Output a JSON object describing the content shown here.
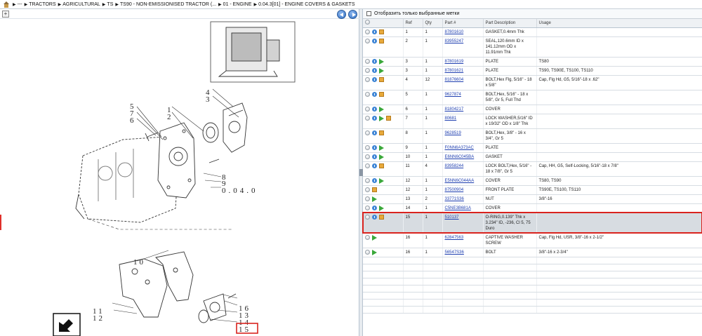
{
  "breadcrumb": [
    "---",
    "TRACTORS",
    "AGRICULTURAL",
    "TS",
    "TS90 - NON-EMISSIONISED TRACTOR (...",
    "01 - ENGINE",
    "0.04.3[01] - ENGINE COVERS & GASKETS"
  ],
  "toolbar": {
    "zoom_label": "+"
  },
  "drawing": {
    "callouts": [
      "1",
      "2",
      "3",
      "4",
      "5",
      "6",
      "7",
      "8",
      "9",
      "10",
      "11",
      "12",
      "13",
      "14",
      "15",
      "16"
    ],
    "group_label": "0.04.0"
  },
  "filter": {
    "label": "Отобразить только выбранные метки"
  },
  "table": {
    "columns": [
      "Ref",
      "Qty",
      "Part #",
      "Part Description",
      "Usage"
    ],
    "rows": [
      {
        "icons": [
          "circle",
          "info",
          "box"
        ],
        "ref": "1",
        "qty": "1",
        "part": "87801610",
        "desc": "GASKET,0.4mm Thk",
        "usage": ""
      },
      {
        "icons": [
          "circle",
          "info",
          "box"
        ],
        "ref": "2",
        "qty": "1",
        "part": "83955247",
        "desc": "SEAL,120.6mm ID x 141.12mm OD x 11.91mm Thk",
        "usage": ""
      },
      {
        "icons": [
          "circle",
          "info",
          "arrow"
        ],
        "ref": "3",
        "qty": "1",
        "part": "87801619",
        "desc": "PLATE",
        "usage": "TS80"
      },
      {
        "icons": [
          "circle",
          "info",
          "arrow"
        ],
        "ref": "3",
        "qty": "1",
        "part": "87801621",
        "desc": "PLATE",
        "usage": "TS90, TS90E, TS100, TS110"
      },
      {
        "icons": [
          "circle",
          "info",
          "box"
        ],
        "ref": "4",
        "qty": "12",
        "part": "81876604",
        "desc": "BOLT,Hex Flg, 5/16\" - 18 x 5/8\"",
        "usage": "Cap, Flg Hd, G5, 5/16\"-18 x .62\""
      },
      {
        "icons": [
          "circle",
          "info",
          "box"
        ],
        "ref": "5",
        "qty": "1",
        "part": "9627874",
        "desc": "BOLT,Hex, 5/16\" - 18 x 5/8\", Gr 5, Full Thd",
        "usage": ""
      },
      {
        "icons": [
          "circle",
          "info",
          "arrow"
        ],
        "ref": "6",
        "qty": "1",
        "part": "81804217",
        "desc": "COVER",
        "usage": ""
      },
      {
        "icons": [
          "circle",
          "info",
          "arrow",
          "box"
        ],
        "ref": "7",
        "qty": "1",
        "part": "80681",
        "desc": "LOCK WASHER,5/16\" ID x 19/32\" OD x 1/8\" Thk",
        "usage": ""
      },
      {
        "icons": [
          "circle",
          "info",
          "box"
        ],
        "ref": "8",
        "qty": "1",
        "part": "9628519",
        "desc": "BOLT,Hex, 3/8\" - 16 x 3/4\", Gr 5",
        "usage": ""
      },
      {
        "icons": [
          "circle",
          "info",
          "arrow"
        ],
        "ref": "9",
        "qty": "1",
        "part": "F0NN6A373AC",
        "desc": "PLATE",
        "usage": ""
      },
      {
        "icons": [
          "circle",
          "info",
          "arrow"
        ],
        "ref": "10",
        "qty": "1",
        "part": "E6NN6C045BA",
        "desc": "GASKET",
        "usage": ""
      },
      {
        "icons": [
          "circle",
          "info",
          "box"
        ],
        "ref": "11",
        "qty": "4",
        "part": "83958244",
        "desc": "LOCK BOLT,Hex, 5/16\" - 18 x 7/8\", Gr 5",
        "usage": "Cap, HH, G5, Self-Locking, 5/16\"-18 x 7/8\""
      },
      {
        "icons": [
          "circle",
          "info",
          "arrow"
        ],
        "ref": "12",
        "qty": "1",
        "part": "E5NN6C044AA",
        "desc": "COVER",
        "usage": "TS80, TS90"
      },
      {
        "icons": [
          "circle",
          "box"
        ],
        "ref": "12",
        "qty": "1",
        "part": "87500904",
        "desc": "FRONT PLATE",
        "usage": "TS90E, TS100, TS110"
      },
      {
        "icons": [
          "circle",
          "arrow"
        ],
        "ref": "13",
        "qty": "2",
        "part": "33771S36",
        "desc": "NUT",
        "usage": "3/8\"-16"
      },
      {
        "icons": [
          "circle",
          "info",
          "arrow"
        ],
        "ref": "14",
        "qty": "1",
        "part": "C5NE3B681A",
        "desc": "COVER",
        "usage": ""
      },
      {
        "icons": [
          "circle",
          "info",
          "box"
        ],
        "ref": "15",
        "qty": "1",
        "part": "510137",
        "desc": "O-RING,0.139\" Thk x 3.234\" ID, -236, Cl 5, 75 Duro",
        "usage": "",
        "selected": true
      },
      {
        "icons": [
          "circle",
          "arrow"
        ],
        "ref": "16",
        "qty": "1",
        "part": "62847563",
        "desc": "CAPTIVE WASHER SCREW",
        "usage": "Cap, Flg Hd, USR, 3/8\"-16 x 2-1/2\""
      },
      {
        "icons": [
          "circle",
          "arrow"
        ],
        "ref": "16",
        "qty": "1",
        "part": "56547S36",
        "desc": "BOLT",
        "usage": "3/8\"-16 x 2-3/4\""
      }
    ]
  },
  "colors": {
    "selection_outline": "#d9231e",
    "link": "#1f3fb0",
    "selected_row": "#d7dce1"
  }
}
